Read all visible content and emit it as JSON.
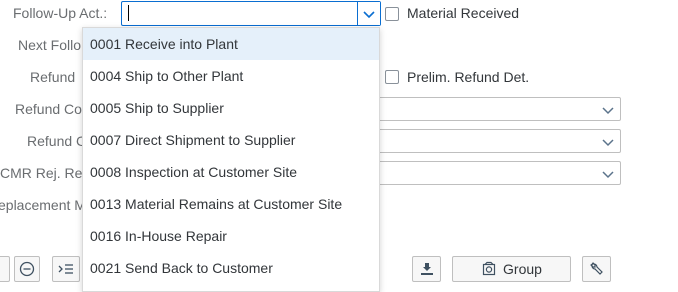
{
  "form": {
    "follow_up_label": "Follow-Up Act.:",
    "follow_up_value": "",
    "next_label": "Next Follo",
    "refund_label": "Refund",
    "refund_co_label": "Refund Co",
    "refund_c_label": "Refund C",
    "cmr_label": "CMR Rej. Re",
    "replacement_label": "eplacement M",
    "material_received_label": "Material Received",
    "prelim_refund_label": "Prelim. Refund Det."
  },
  "dropdown": {
    "items": [
      "0001 Receive into Plant",
      "0004 Ship to Other Plant",
      "0005 Ship to Supplier",
      "0007 Direct Shipment to Supplier",
      "0008 Inspection at Customer Site",
      "0013 Material Remains at Customer Site",
      "0016 In-House Repair",
      "0021 Send Back to Customer"
    ]
  },
  "toolbar": {
    "group_label": "Group"
  },
  "icons": {
    "chevron": "chevron-down-icon",
    "collapse": "minus-circle-icon",
    "indent": "indent-icon",
    "export": "export-icon",
    "group": "group-icon",
    "settings": "wrench-icon"
  },
  "colors": {
    "accent": "#0a6ed1",
    "selected_row": "#e5f0fa",
    "label": "#6a6d70"
  }
}
